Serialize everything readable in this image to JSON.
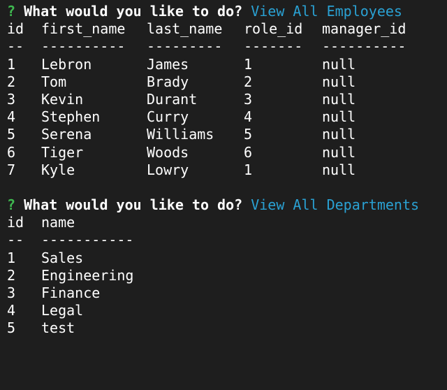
{
  "employees_prompt": {
    "marker": "?",
    "question": "What would you like to do?",
    "answer": "View All Employees"
  },
  "employees_table": {
    "headers": [
      "id",
      "first_name",
      "last_name",
      "role_id",
      "manager_id"
    ],
    "separators": [
      "--",
      "----------",
      "---------",
      "-------",
      "----------"
    ],
    "rows": [
      [
        "1",
        "Lebron",
        "James",
        "1",
        "null"
      ],
      [
        "2",
        "Tom",
        "Brady",
        "2",
        "null"
      ],
      [
        "3",
        "Kevin",
        "Durant",
        "3",
        "null"
      ],
      [
        "4",
        "Stephen",
        "Curry",
        "4",
        "null"
      ],
      [
        "5",
        "Serena",
        "Williams",
        "5",
        "null"
      ],
      [
        "6",
        "Tiger",
        "Woods",
        "6",
        "null"
      ],
      [
        "7",
        "Kyle",
        "Lowry",
        "1",
        "null"
      ]
    ]
  },
  "departments_prompt": {
    "marker": "?",
    "question": "What would you like to do?",
    "answer": "View All Departments"
  },
  "departments_table": {
    "headers": [
      "id",
      "name"
    ],
    "separators": [
      "--",
      "-----------"
    ],
    "rows": [
      [
        "1",
        "Sales"
      ],
      [
        "2",
        "Engineering"
      ],
      [
        "3",
        "Finance"
      ],
      [
        "4",
        "Legal"
      ],
      [
        "5",
        "test"
      ]
    ]
  },
  "colors": {
    "background": "#1e1e1e",
    "text": "#ffffff",
    "prompt_marker": "#3fb950",
    "answer": "#2aa1d3"
  }
}
